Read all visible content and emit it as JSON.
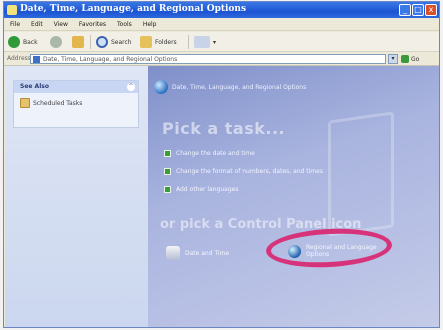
{
  "window": {
    "title": "Date, Time, Language, and Regional Options",
    "buttons": [
      "_",
      "□",
      "x"
    ]
  },
  "menubar": {
    "items": [
      "File",
      "Edit",
      "View",
      "Favorites",
      "Tools",
      "Help"
    ]
  },
  "toolbar": {
    "back_label": "Back",
    "search_label": "Search",
    "folders_label": "Folders"
  },
  "address": {
    "label": "Address",
    "value": "Date, Time, Language, and Regional Options",
    "go_label": "Go"
  },
  "sidepane": {
    "see_also_title": "See Also",
    "collapse_glyph": "^",
    "links": [
      "Scheduled Tasks"
    ]
  },
  "main": {
    "category_title": "Date, Time, Language, and Regional Options",
    "pick_task": "Pick a task...",
    "tasks": [
      "Change the date and time",
      "Change the format of numbers, dates, and times",
      "Add other languages"
    ],
    "pick_icon": "or pick a Control Panel icon",
    "icons": [
      {
        "label_lines": [
          "Date and Time"
        ]
      },
      {
        "label_lines": [
          "Regional and Language",
          "Options"
        ]
      }
    ]
  },
  "colors": {
    "highlight": "#d6337a",
    "titlebar": "#1c54d2"
  }
}
